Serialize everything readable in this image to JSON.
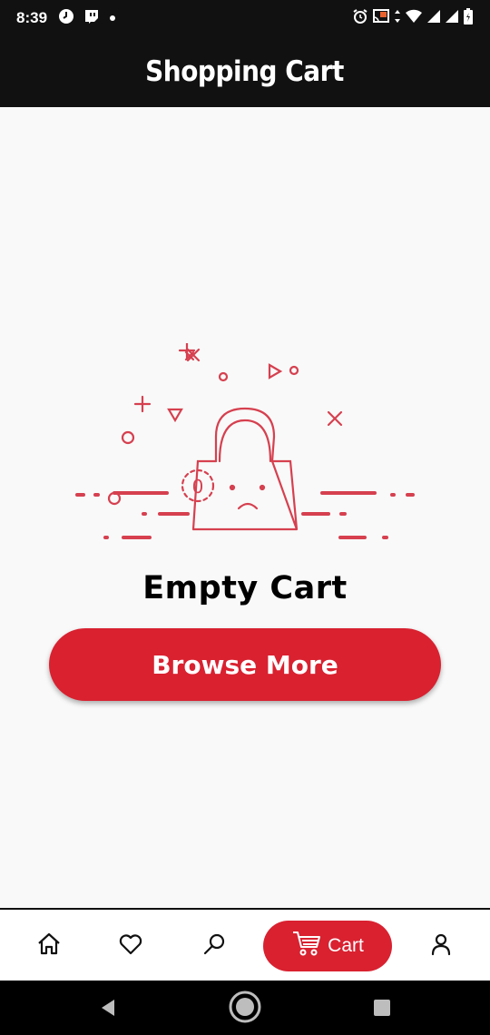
{
  "status_bar": {
    "time": "8:39",
    "left_icons": [
      "clock-icon",
      "twitch-icon",
      "dot-icon"
    ],
    "right_icons": [
      "alarm-icon",
      "cast-icon",
      "data-arrows-icon",
      "wifi-icon",
      "signal-icon",
      "signal-icon",
      "battery-icon"
    ]
  },
  "header": {
    "title": "Shopping Cart"
  },
  "main": {
    "illustration": {
      "badge_count": "0",
      "name": "empty-cart-bag"
    },
    "empty_title": "Empty Cart",
    "browse_button_label": "Browse More"
  },
  "bottom_nav": {
    "items": [
      {
        "name": "home",
        "icon": "home-icon"
      },
      {
        "name": "favorites",
        "icon": "heart-icon"
      },
      {
        "name": "search",
        "icon": "search-icon"
      },
      {
        "name": "cart",
        "icon": "cart-icon",
        "label": "Cart",
        "active": true
      },
      {
        "name": "profile",
        "icon": "user-icon"
      }
    ]
  },
  "system_nav": [
    "back-icon",
    "home-circle-icon",
    "recents-icon"
  ],
  "colors": {
    "accent": "#d92130",
    "illustration": "#d6404f",
    "bar": "#111111",
    "background": "#f9f9f9"
  }
}
